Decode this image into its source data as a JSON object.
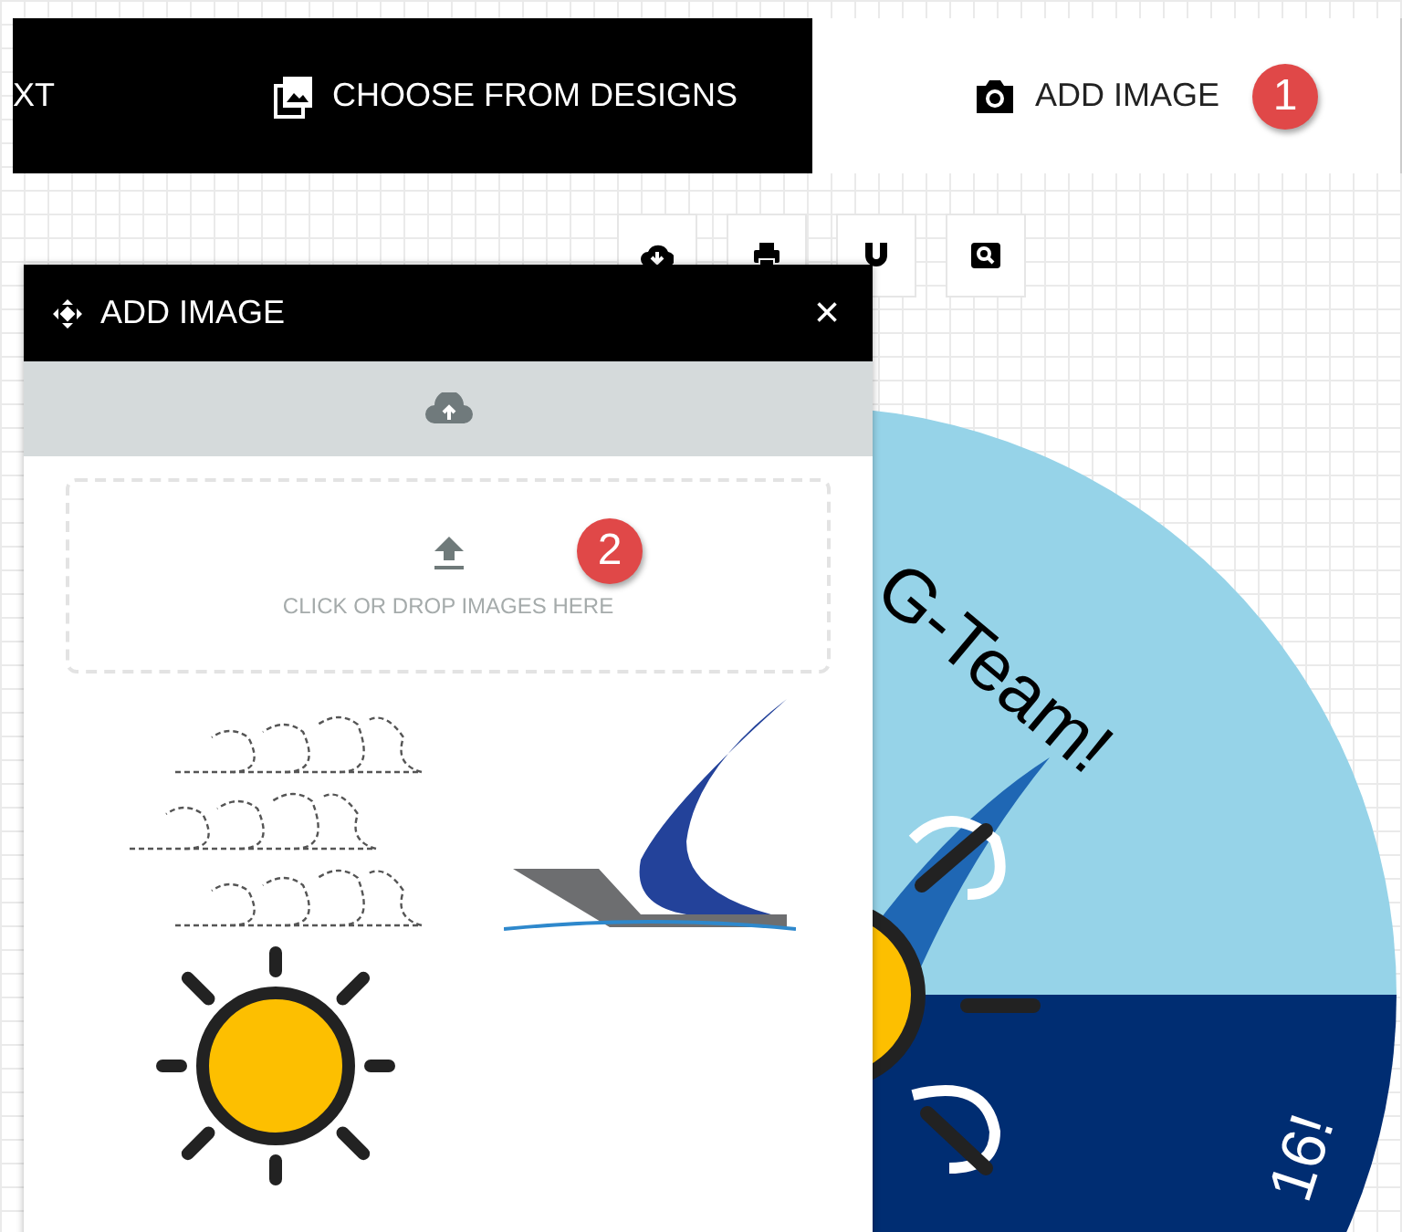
{
  "tabs": [
    {
      "label": "XT",
      "kind": "text",
      "selected": false
    },
    {
      "label": "CHOOSE FROM DESIGNS",
      "kind": "designs",
      "selected": false
    },
    {
      "label": "ADD IMAGE",
      "kind": "image",
      "selected": true
    }
  ],
  "callouts": [
    {
      "label": "1"
    },
    {
      "label": "2"
    }
  ],
  "panel": {
    "title": "ADD IMAGE",
    "close": "×",
    "dropzone_text": "CLICK OR DROP IMAGES HERE"
  },
  "design": {
    "texts": [
      "G-Team!",
      "16!"
    ]
  }
}
